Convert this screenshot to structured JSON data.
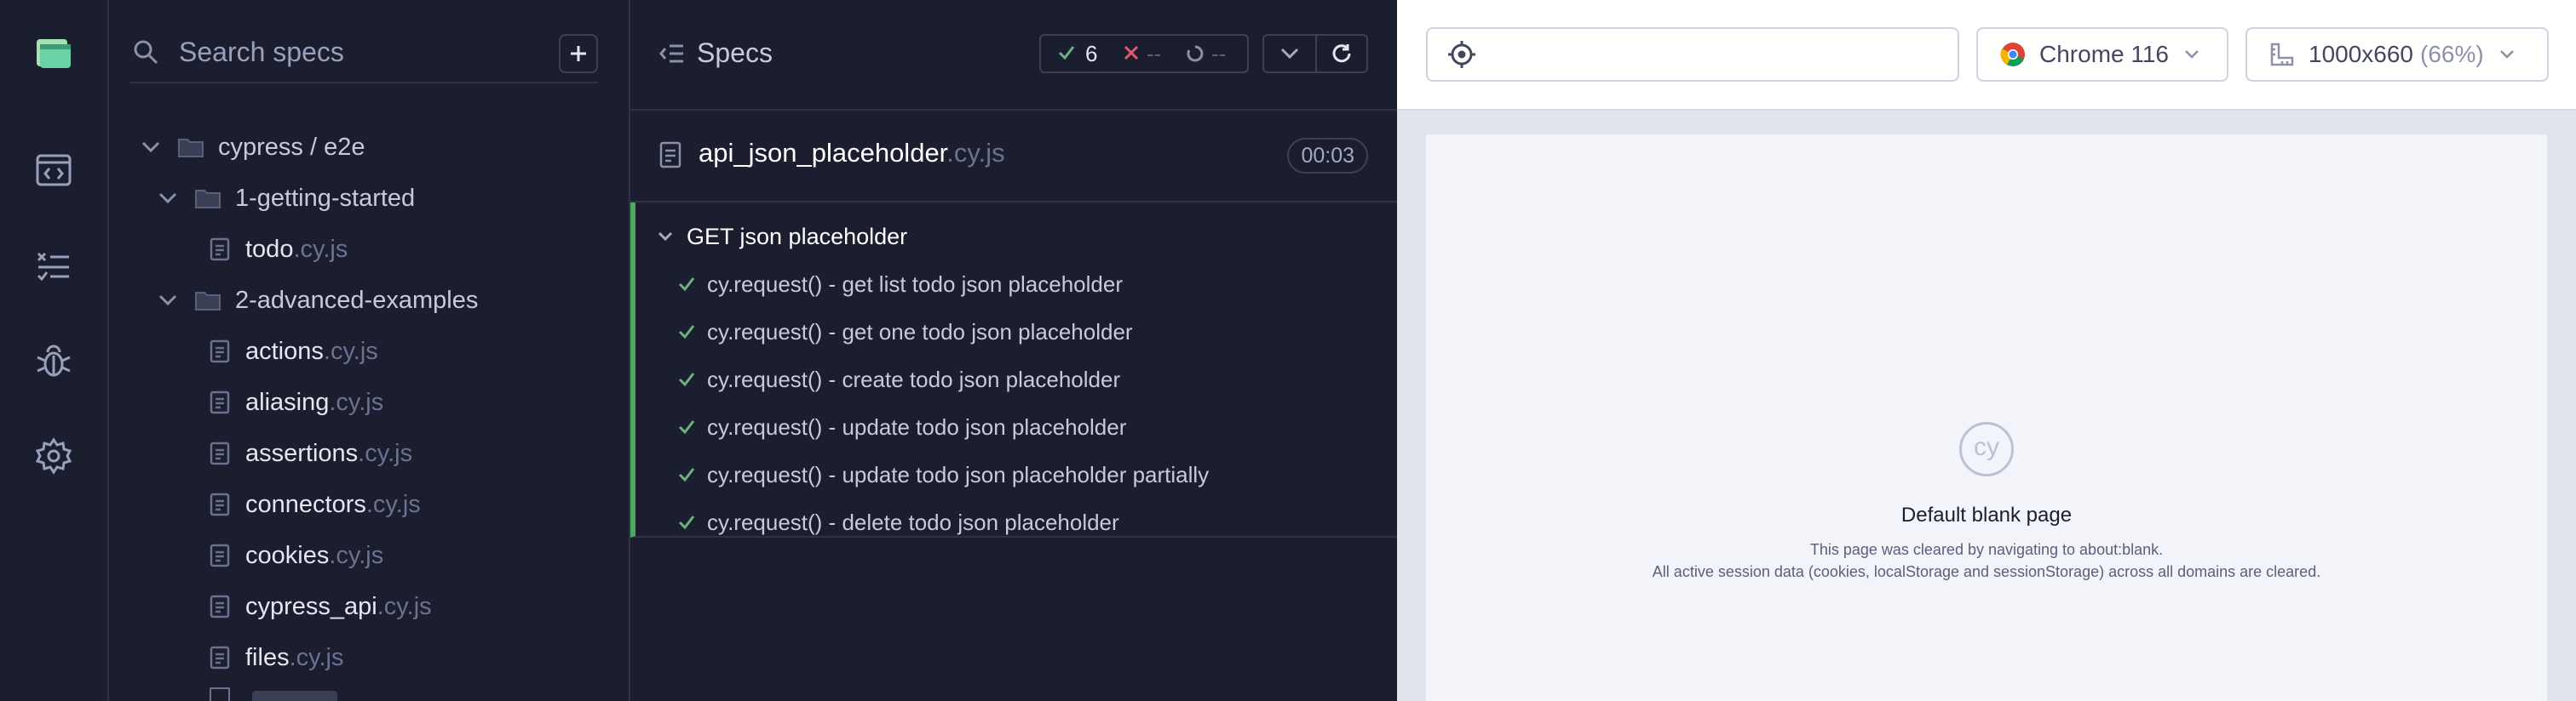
{
  "search": {
    "placeholder": "Search specs"
  },
  "tree": {
    "root": "cypress / e2e",
    "folders": [
      {
        "name": "1-getting-started",
        "files": [
          {
            "name": "todo",
            "ext": ".cy.js"
          }
        ]
      },
      {
        "name": "2-advanced-examples",
        "files": [
          {
            "name": "actions",
            "ext": ".cy.js"
          },
          {
            "name": "aliasing",
            "ext": ".cy.js"
          },
          {
            "name": "assertions",
            "ext": ".cy.js"
          },
          {
            "name": "connectors",
            "ext": ".cy.js"
          },
          {
            "name": "cookies",
            "ext": ".cy.js"
          },
          {
            "name": "cypress_api",
            "ext": ".cy.js"
          },
          {
            "name": "files",
            "ext": ".cy.js"
          }
        ]
      }
    ]
  },
  "reporter": {
    "title": "Specs",
    "stats": {
      "passed": "6",
      "failed": "--",
      "pending": "--"
    },
    "spec": {
      "name": "api_json_placeholder",
      "ext": ".cy.js",
      "duration": "00:03"
    },
    "suite": {
      "title": "GET json placeholder",
      "tests": [
        "cy.request() - get list todo json placeholder",
        "cy.request() - get one todo json placeholder",
        "cy.request() - create todo json placeholder",
        "cy.request() - update todo json placeholder",
        "cy.request() - update todo json placeholder partially",
        "cy.request() - delete todo json placeholder"
      ]
    }
  },
  "aut": {
    "url": "",
    "browser": "Chrome 116",
    "viewport_size": "1000x660",
    "viewport_scale": "(66%)",
    "blank_page": {
      "logo": "cy",
      "title": "Default blank page",
      "line1": "This page was cleared by navigating to about:blank.",
      "line2": "All active session data (cookies, localStorage and sessionStorage) across all domains are cleared."
    }
  },
  "colors": {
    "pass": "#4fa764",
    "fail": "#e45770",
    "background": "#1b1e2e",
    "accent": "#6bb37a"
  }
}
